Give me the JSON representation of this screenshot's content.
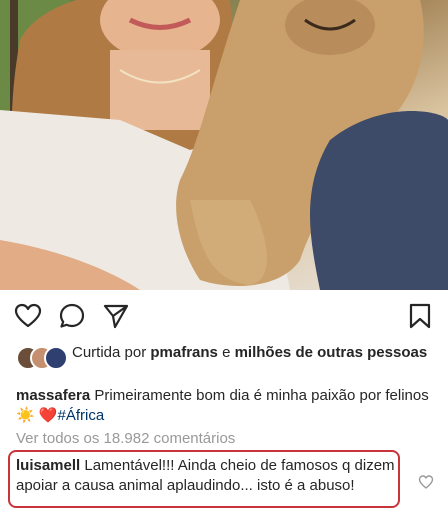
{
  "post": {
    "photo_alt": "woman-holding-lion-cub"
  },
  "actions": {
    "like_icon": "heart-outline-icon",
    "comment_icon": "comment-bubble-icon",
    "share_icon": "paper-plane-icon",
    "save_icon": "bookmark-icon"
  },
  "likes": {
    "prefix": "Curtida por ",
    "user": "pmafrans",
    "connector": " e ",
    "others": "milhões de outras pessoas"
  },
  "caption": {
    "username": "massafera",
    "text": " Primeiramente bom dia é minha paixão por felinos ",
    "emoji_sun": "☀️",
    "emoji_heart": "❤️",
    "hashtag": "#África"
  },
  "comments": {
    "view_all": "Ver todos os 18.982 comentários"
  },
  "highlight_comment": {
    "username": "luisamell",
    "text": " Lamentável!!! Ainda cheio de famosos q dizem apoiar a causa animal aplaudindo... isto é a abuso!"
  },
  "colors": {
    "highlight_border": "#c9343a",
    "hashtag": "#003569",
    "muted": "#999999"
  }
}
